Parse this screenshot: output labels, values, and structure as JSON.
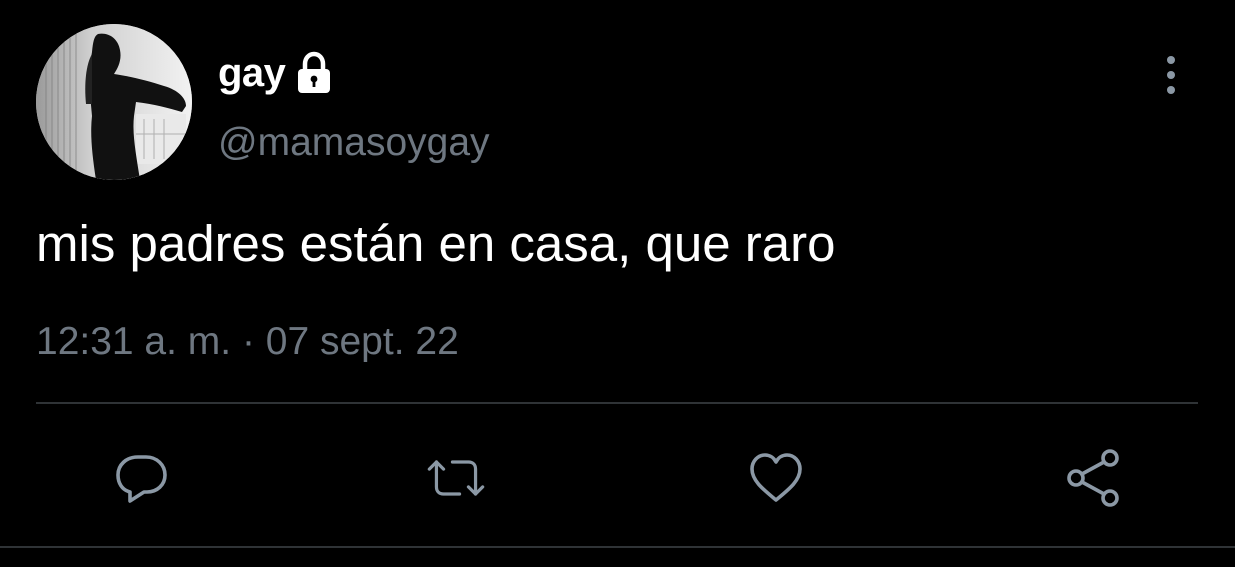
{
  "author": {
    "display_name": "gay",
    "handle": "@mamasoygay",
    "protected_icon": "lock-icon",
    "avatar": "profile-photo"
  },
  "tweet": {
    "text": "mis padres están en casa, que raro",
    "timestamp": "12:31 a. m. · 07 sept. 22"
  },
  "actions": [
    {
      "icon": "reply-icon"
    },
    {
      "icon": "retweet-icon"
    },
    {
      "icon": "like-icon"
    },
    {
      "icon": "share-icon"
    }
  ],
  "colors": {
    "background": "#000000",
    "text_primary": "#ffffff",
    "text_secondary": "#6e7781",
    "icon": "#8b98a5",
    "divider": "#2f3336"
  }
}
